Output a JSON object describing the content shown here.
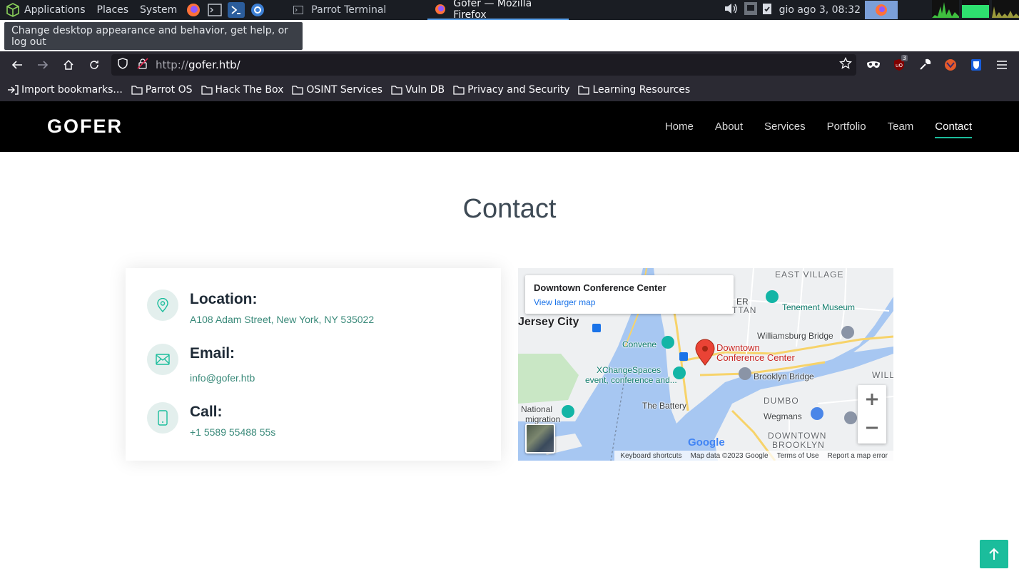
{
  "os": {
    "menus": [
      "Applications",
      "Places",
      "System"
    ],
    "tasks": [
      {
        "label": "Parrot Terminal",
        "active": false
      },
      {
        "label": "Gofer — Mozilla Firefox",
        "active": true
      }
    ],
    "clock": "gio ago  3, 08:32",
    "tooltip": "Change desktop appearance and behavior, get help, or log out"
  },
  "browser": {
    "url_protocol": "http://",
    "url_host": "gofer.htb/",
    "ublock_count": "3",
    "bookmarks": [
      "Import bookmarks...",
      "Parrot OS",
      "Hack The Box",
      "OSINT Services",
      "Vuln DB",
      "Privacy and Security",
      "Learning Resources"
    ]
  },
  "site": {
    "logo": "GOFER",
    "nav": [
      "Home",
      "About",
      "Services",
      "Portfolio",
      "Team",
      "Contact"
    ],
    "active_nav": "Contact",
    "accent": "#1bbd9c",
    "section_title": "Contact",
    "location_title": "Location:",
    "location_text": "A108 Adam Street, New York, NY 535022",
    "email_title": "Email:",
    "email_text": "info@gofer.htb",
    "call_title": "Call:",
    "call_text": "+1 5589 55488 55s"
  },
  "map": {
    "place_name": "Downtown Conference Center",
    "larger_map": "View larger map",
    "labels": {
      "east_village": "EAST VILLAGE",
      "tenement": "Tenement Museum",
      "jersey_city": "Jersey City",
      "williamsburg": "Williamsburg Bridge",
      "convene": "Convene",
      "pin_label_1": "Downtown",
      "pin_label_2": "Conference Center",
      "xchange_1": "XChangeSpaces",
      "xchange_2": "event, conference and...",
      "brooklyn_bridge": "Brooklyn Bridge",
      "dumbo": "DUMBO",
      "battery": "The Battery",
      "wegmans": "Wegmans",
      "national": "National",
      "migration": "migration",
      "downtown_brooklyn_1": "DOWNTOWN",
      "downtown_brooklyn_2": "BROOKLYN",
      "ttan": "TTAN",
      "er": "ER",
      "will": "WILL"
    },
    "attribution": [
      "Keyboard shortcuts",
      "Map data ©2023 Google",
      "Terms of Use",
      "Report a map error"
    ],
    "google": "Google"
  }
}
